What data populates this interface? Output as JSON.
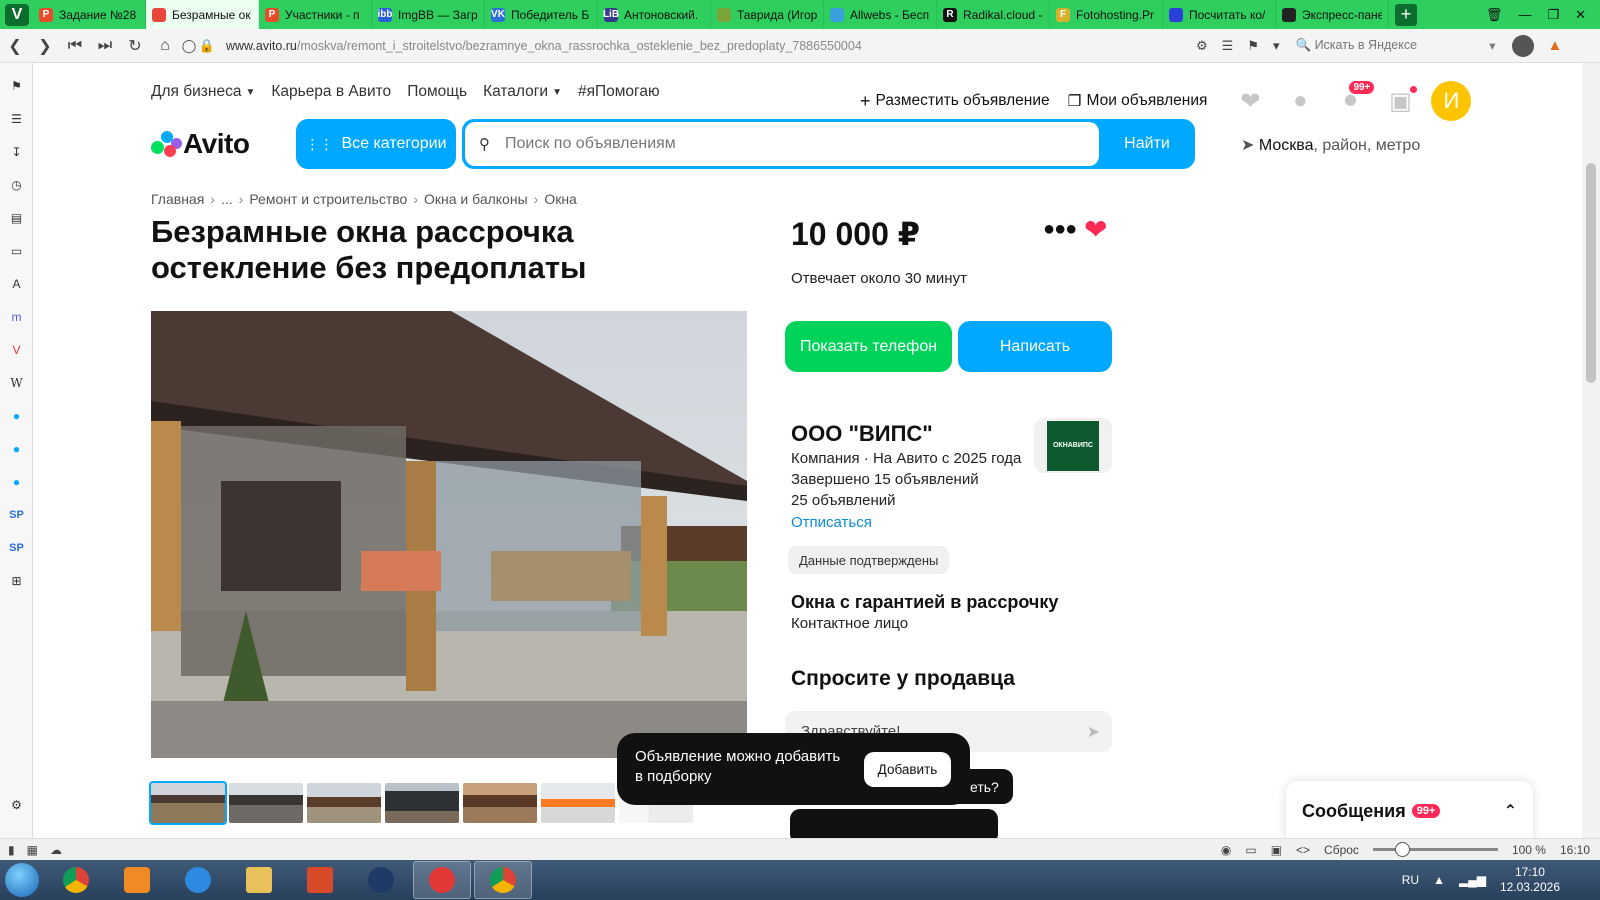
{
  "browser": {
    "tabs": [
      {
        "label": "Задание №28",
        "color": "#e94b2b",
        "glyph": "P",
        "active": false
      },
      {
        "label": "Безрамные ок",
        "color": "#e8473c",
        "glyph": "",
        "active": true
      },
      {
        "label": "Участники - п",
        "color": "#e94b2b",
        "glyph": "P",
        "active": false
      },
      {
        "label": "ImgBB — Загр",
        "color": "#2b5fd9",
        "glyph": "ibb",
        "active": false
      },
      {
        "label": "Победитель Б",
        "color": "#2b6fd9",
        "glyph": "VK",
        "active": false
      },
      {
        "label": "Антоновский.",
        "color": "#3a3a8c",
        "glyph": "LiB",
        "active": false
      },
      {
        "label": "Таврида (Игор",
        "color": "#7aa33a",
        "glyph": "",
        "active": false
      },
      {
        "label": "Allwebs - Бесп",
        "color": "#3aa0d9",
        "glyph": "",
        "active": false
      },
      {
        "label": "Radikal.cloud -",
        "color": "#111111",
        "glyph": "R",
        "active": false
      },
      {
        "label": "Fotohosting.Pr",
        "color": "#d9b02b",
        "glyph": "F",
        "active": false
      },
      {
        "label": "Посчитать ко/",
        "color": "#2b3fd9",
        "glyph": "",
        "active": false
      },
      {
        "label": "Экспресс-пане",
        "color": "#222222",
        "glyph": "",
        "active": false
      }
    ],
    "url_host": "www.avito.ru",
    "url_path": "/moskva/remont_i_stroitelstvo/bezramnye_okna_rassrochka_osteklenie_bez_predoplaty_7886550004",
    "yandex_search_placeholder": "Искать в Яндексе",
    "status": {
      "reset_label": "Сброс",
      "zoom": "100 %",
      "time": "16:10"
    }
  },
  "site": {
    "top_links": [
      "Для бизнеса",
      "Карьера в Авито",
      "Помощь",
      "Каталоги",
      "#яПомогаю"
    ],
    "post_ad": "Разместить объявление",
    "my_ads": "Мои объявления",
    "messages_badge": "99+",
    "avatar_letter": "И",
    "logo_text": "Avito",
    "all_categories": "Все категории",
    "search_placeholder": "Поиск по объявлениям",
    "search_button": "Найти",
    "location_city": "Москва",
    "location_rest": ", район, метро",
    "breadcrumbs": [
      "Главная",
      "...",
      "Ремонт и строительство",
      "Окна и балконы",
      "Окна"
    ],
    "title": "Безрамные окна рассрочка остекление без предоплаты",
    "price": "10 000 ₽",
    "reply_time": "Отвечает около 30 минут",
    "show_phone": "Показать телефон",
    "write": "Написать",
    "seller": {
      "name": "ООО \"ВИПС\"",
      "line1": "Компания · На Авито с 2025 года",
      "line2": "Завершено 15 объявлений",
      "line3": "25 объявлений",
      "unsubscribe": "Отписаться",
      "logo_text": "ОКНАВИПС",
      "verified": "Данные подтверждены"
    },
    "contact_title": "Окна с гарантией в рассрочку",
    "contact_sub": "Контактное лицо",
    "ask_title": "Спросите у продавца",
    "ask_input": "Здравствуйте!",
    "ask_chip": "еть?",
    "toast_text": "Объявление можно добавить в подборку",
    "toast_button": "Добавить",
    "messages_panel": "Сообщения",
    "messages_panel_badge": "99+"
  },
  "taskbar": {
    "lang": "RU",
    "time": "17:10",
    "date": "12.03.2026"
  }
}
